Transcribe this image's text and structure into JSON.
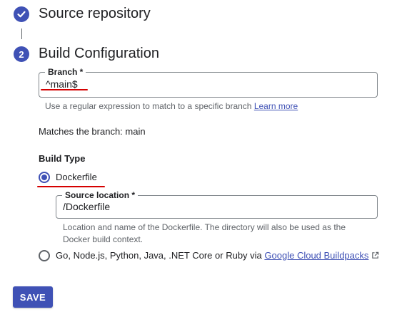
{
  "steps": [
    {
      "number": "",
      "title": "Source repository",
      "status": "completed",
      "icon": "check-icon"
    },
    {
      "number": "2",
      "title": "Build Configuration",
      "status": "active"
    }
  ],
  "branch": {
    "label": "Branch *",
    "value": "^main$",
    "hint": "Use a regular expression to match to a specific branch",
    "learn_more": "Learn more",
    "matches_text": "Matches the branch: main"
  },
  "build_type": {
    "heading": "Build Type",
    "options": [
      {
        "label": "Dockerfile",
        "selected": true
      },
      {
        "label": "Go, Node.js, Python, Java, .NET Core or Ruby via",
        "link": "Google Cloud Buildpacks",
        "link_icon": "external-link-icon",
        "selected": false
      }
    ],
    "source_location": {
      "label": "Source location *",
      "value": "/Dockerfile",
      "hint_line1": "Location and name of the Dockerfile. The directory will also be used as the",
      "hint_line2": "Docker build context."
    }
  },
  "save_label": "SAVE",
  "colors": {
    "accent": "#3f51b5",
    "annotation": "#d50000"
  }
}
